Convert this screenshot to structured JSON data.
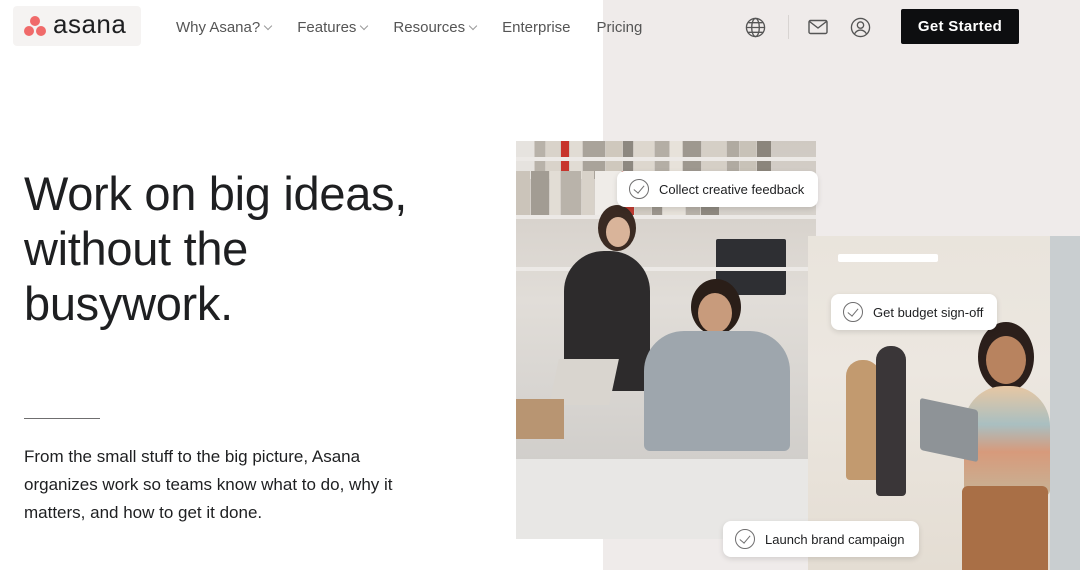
{
  "brand": {
    "name": "asana",
    "color": "#f06a6a"
  },
  "nav": {
    "items": [
      {
        "label": "Why Asana?",
        "dropdown": true
      },
      {
        "label": "Features",
        "dropdown": true
      },
      {
        "label": "Resources",
        "dropdown": true
      },
      {
        "label": "Enterprise",
        "dropdown": false
      },
      {
        "label": "Pricing",
        "dropdown": false
      }
    ],
    "icons": [
      "globe-icon",
      "mail-icon",
      "user-icon"
    ],
    "cta_label": "Get Started"
  },
  "hero": {
    "title_lines": [
      "Work on big ideas,",
      "without the",
      "busywork."
    ],
    "subtitle": "From the small stuff to the big picture, Asana organizes work so teams know what to do, why it matters, and how to get it done."
  },
  "tasks": [
    {
      "label": "Collect creative feedback"
    },
    {
      "label": "Get budget sign-off"
    },
    {
      "label": "Launch brand campaign"
    }
  ],
  "colors": {
    "accent_bg": "#efebea",
    "cta_bg": "#0d0e10"
  }
}
